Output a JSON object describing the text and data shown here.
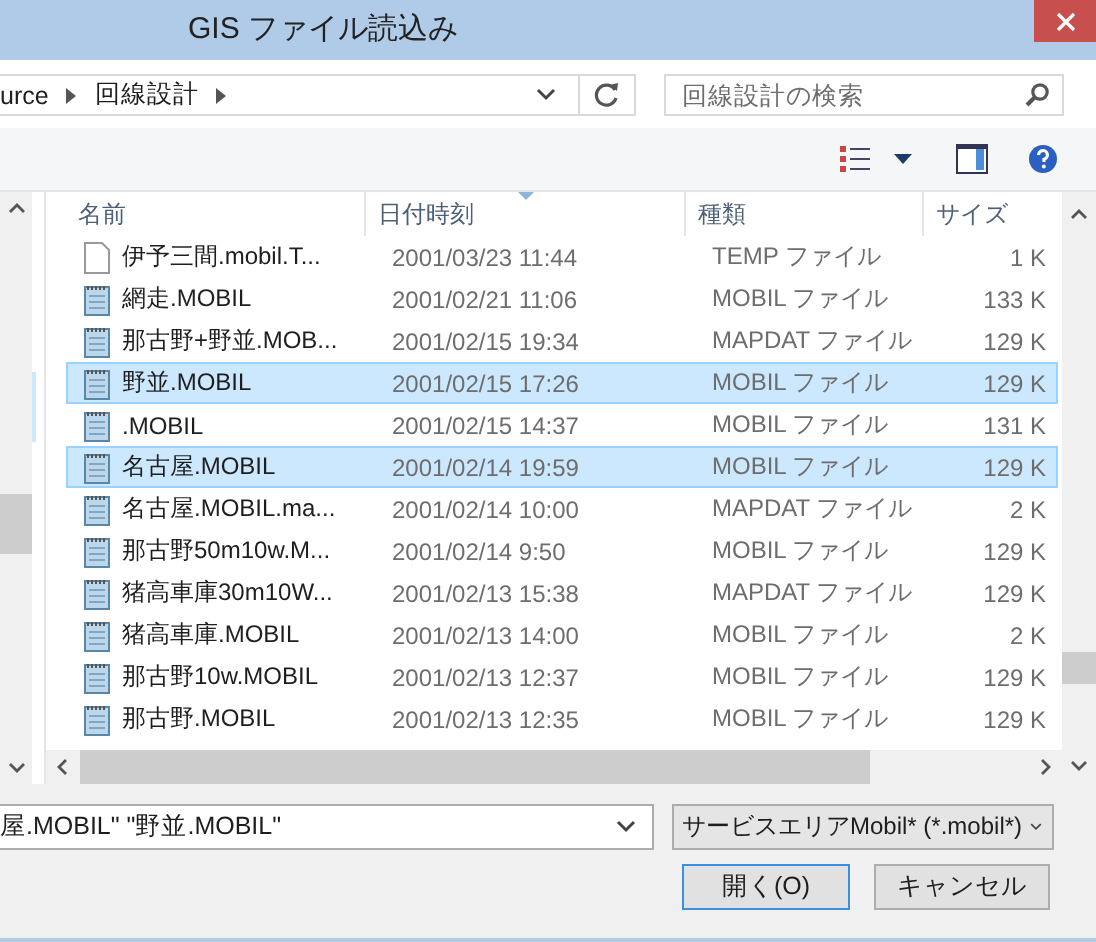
{
  "window": {
    "title": "GIS ファイル読込み"
  },
  "address": {
    "crumbs": [
      "urce",
      "回線設計"
    ]
  },
  "search": {
    "placeholder": "回線設計の検索"
  },
  "table": {
    "columns": [
      "名前",
      "日付時刻",
      "種類",
      "サイズ"
    ],
    "rows": [
      {
        "kind": "blank",
        "name": "伊予三間.mobil.T...",
        "date": "2001/03/23 11:44",
        "type": "TEMP ファイル",
        "size": "1 K",
        "selected": false
      },
      {
        "kind": "data",
        "name": "網走.MOBIL",
        "date": "2001/02/21 11:06",
        "type": "MOBIL ファイル",
        "size": "133 K",
        "selected": false
      },
      {
        "kind": "data",
        "name": "那古野+野並.MOB...",
        "date": "2001/02/15 19:34",
        "type": "MAPDAT ファイル",
        "size": "129 K",
        "selected": false
      },
      {
        "kind": "data",
        "name": "野並.MOBIL",
        "date": "2001/02/15 17:26",
        "type": "MOBIL ファイル",
        "size": "129 K",
        "selected": true
      },
      {
        "kind": "data",
        "name": ".MOBIL",
        "date": "2001/02/15 14:37",
        "type": "MOBIL ファイル",
        "size": "131 K",
        "selected": false
      },
      {
        "kind": "data",
        "name": "名古屋.MOBIL",
        "date": "2001/02/14 19:59",
        "type": "MOBIL ファイル",
        "size": "129 K",
        "selected": true
      },
      {
        "kind": "data",
        "name": "名古屋.MOBIL.ma...",
        "date": "2001/02/14 10:00",
        "type": "MAPDAT ファイル",
        "size": "2 K",
        "selected": false
      },
      {
        "kind": "data",
        "name": "那古野50m10w.M...",
        "date": "2001/02/14 9:50",
        "type": "MOBIL ファイル",
        "size": "129 K",
        "selected": false
      },
      {
        "kind": "data",
        "name": "猪高車庫30m10W...",
        "date": "2001/02/13 15:38",
        "type": "MAPDAT ファイル",
        "size": "129 K",
        "selected": false
      },
      {
        "kind": "data",
        "name": "猪高車庫.MOBIL",
        "date": "2001/02/13 14:00",
        "type": "MOBIL ファイル",
        "size": "2 K",
        "selected": false
      },
      {
        "kind": "data",
        "name": "那古野10w.MOBIL",
        "date": "2001/02/13 12:37",
        "type": "MOBIL ファイル",
        "size": "129 K",
        "selected": false
      },
      {
        "kind": "data",
        "name": "那古野.MOBIL",
        "date": "2001/02/13 12:35",
        "type": "MOBIL ファイル",
        "size": "129 K",
        "selected": false
      }
    ]
  },
  "filename": {
    "value": "屋.MOBIL\" \"野並.MOBIL\""
  },
  "filter": {
    "value": "サービスエリアMobil* (*.mobil*)"
  },
  "buttons": [
    "開く(O)",
    "キャンセル"
  ]
}
